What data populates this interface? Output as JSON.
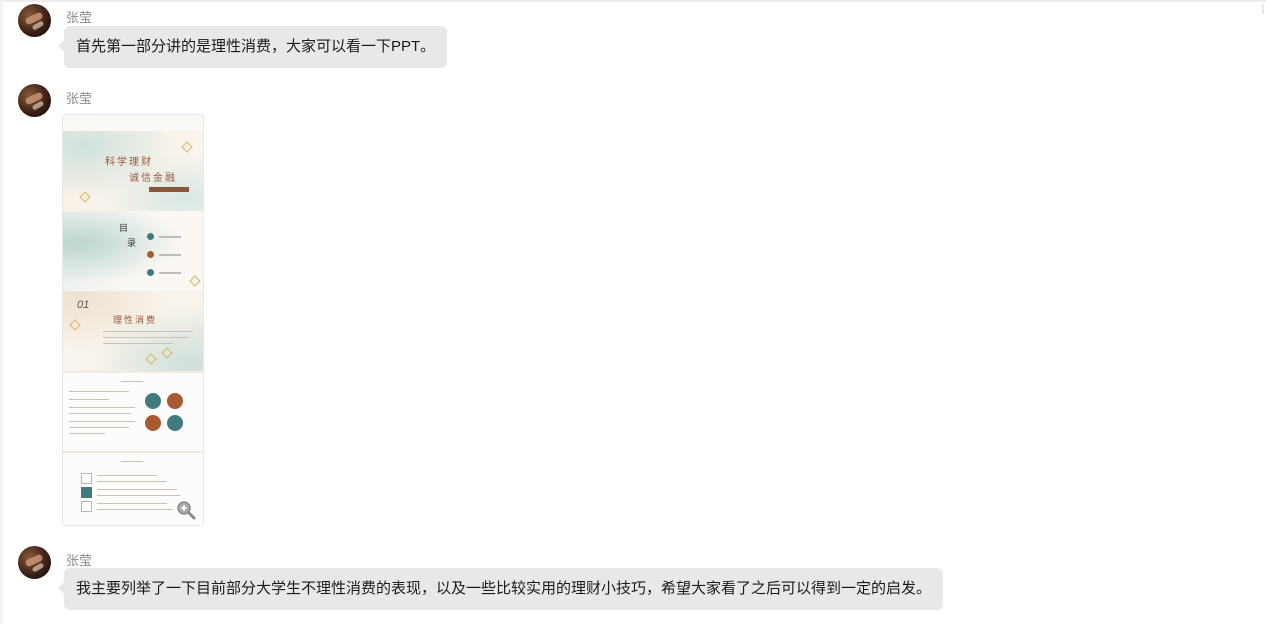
{
  "messages": [
    {
      "sender": "张莹",
      "type": "text",
      "text": "首先第一部分讲的是理性消费，大家可以看一下PPT。"
    },
    {
      "sender": "张莹",
      "type": "image",
      "ppt": {
        "cover_line1": "科学理财",
        "cover_line2": "诚信金融",
        "toc_title_1": "目",
        "toc_title_2": "录",
        "section_number": "01",
        "section_title": "理性消费",
        "accent_colors": [
          "#3f7b80",
          "#a85a33"
        ]
      },
      "zoom_icon": "zoom-in-icon"
    },
    {
      "sender": "张莹",
      "type": "text",
      "text": "我主要列举了一下目前部分大学生不理性消费的表现，以及一些比较实用的理财小技巧，希望大家看了之后可以得到一定的启发。"
    }
  ]
}
